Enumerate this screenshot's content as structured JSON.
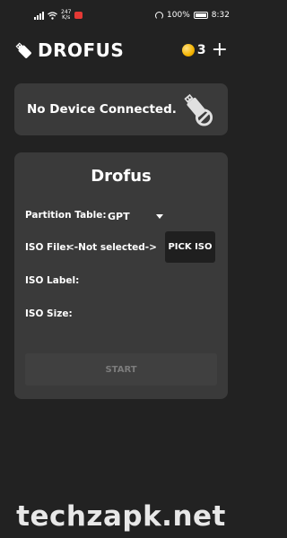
{
  "status_bar": {
    "network_speed_value": "247",
    "network_speed_unit": "K/s",
    "battery": "100%",
    "time": "8:32",
    "icons": [
      "signal-icon",
      "wifi-icon",
      "notification-badge-icon",
      "speedometer-icon",
      "battery-icon"
    ]
  },
  "app_bar": {
    "title": "DROFUS",
    "logo_icon": "usb-drive-icon",
    "coin_count": "3",
    "add_label": "+"
  },
  "device_status": {
    "text": "No Device Connected.",
    "icon": "usb-disconnected-icon"
  },
  "card": {
    "title": "Drofus",
    "partition_label": "Partition Table:",
    "partition_value": "GPT",
    "iso_file_label": "ISO File:",
    "iso_file_value": "<-Not selected->",
    "pick_iso_label": "PICK ISO",
    "iso_label_label": "ISO Label:",
    "iso_size_label": "ISO Size:",
    "start_label": "START"
  },
  "watermark": "techzapk.net",
  "colors": {
    "background": "#222222",
    "card": "#3a3a3a",
    "button_dark": "#1f1f1f",
    "disabled_text": "#7c7c7c",
    "coin": "#f4b400"
  }
}
